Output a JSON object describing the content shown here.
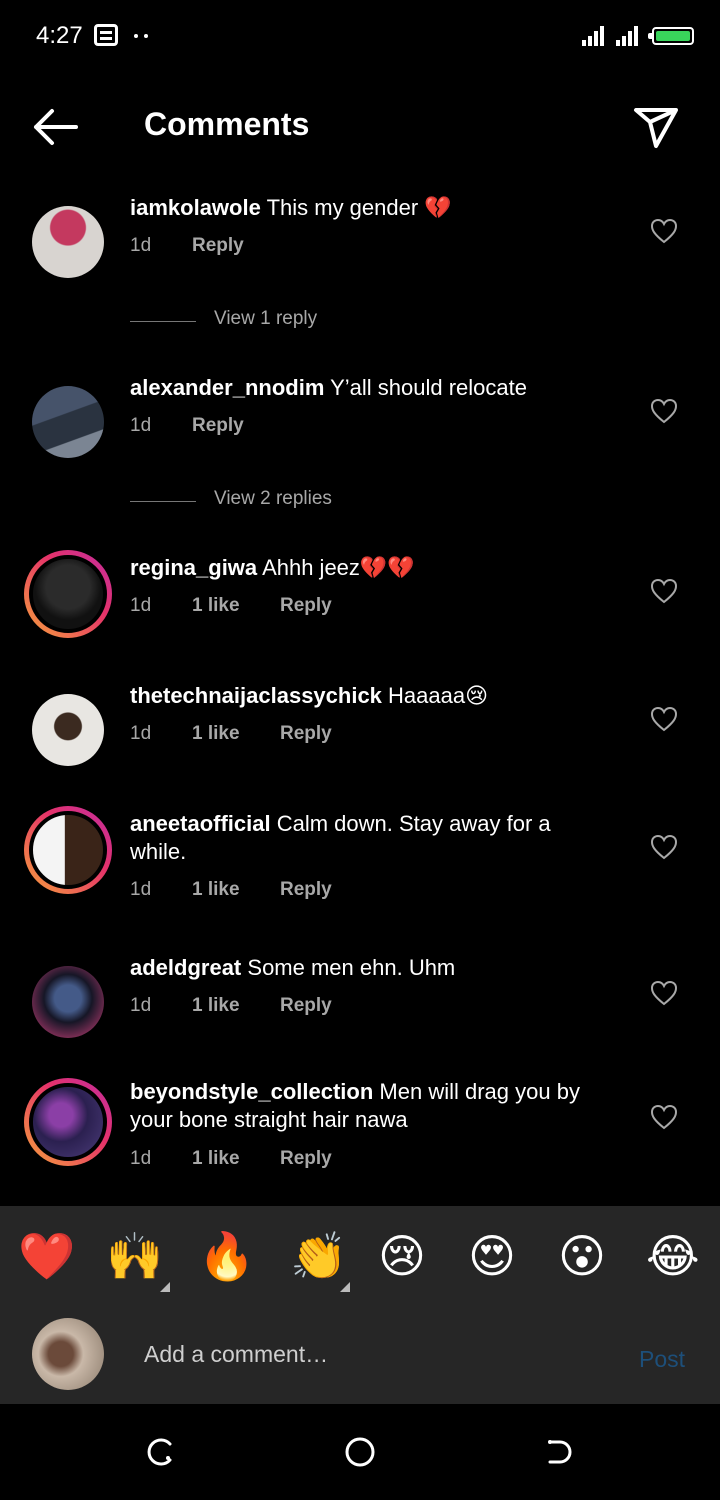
{
  "status_bar": {
    "time": "4:27",
    "battery_color": "#39d45b"
  },
  "header": {
    "title": "Comments",
    "back_icon": "arrow-left-icon",
    "send_icon": "paper-plane-icon"
  },
  "comments": [
    {
      "username": "iamkolawole",
      "text": "This my gender 💔",
      "time": "1d",
      "likes": "",
      "reply": "Reply",
      "ring": false,
      "view_replies": "View 1 reply"
    },
    {
      "username": "alexander_nnodim",
      "text": "Y’all should relocate",
      "time": "1d",
      "likes": "",
      "reply": "Reply",
      "ring": false,
      "view_replies": "View 2 replies"
    },
    {
      "username": "regina_giwa",
      "text": "Ahhh jeez💔💔",
      "time": "1d",
      "likes": "1 like",
      "reply": "Reply",
      "ring": true,
      "view_replies": ""
    },
    {
      "username": "thetechnaijaclassychick",
      "text": "Haaaaa😢",
      "time": "1d",
      "likes": "1 like",
      "reply": "Reply",
      "ring": false,
      "view_replies": ""
    },
    {
      "username": "aneetaofficial",
      "text": "Calm down. Stay away for a while.",
      "time": "1d",
      "likes": "1 like",
      "reply": "Reply",
      "ring": true,
      "view_replies": ""
    },
    {
      "username": "adeldgreat",
      "text": "Some men ehn. Uhm",
      "time": "1d",
      "likes": "1 like",
      "reply": "Reply",
      "ring": false,
      "view_replies": ""
    },
    {
      "username": "beyondstyle_collection",
      "text": "Men will drag you by your bone straight hair nawa",
      "time": "1d",
      "likes": "1 like",
      "reply": "Reply",
      "ring": true,
      "view_replies": ""
    }
  ],
  "emoji_bar": [
    "❤️",
    "🙌",
    "🔥",
    "👏",
    "😢",
    "😍",
    "😮",
    "😂"
  ],
  "comment_box": {
    "placeholder": "Add a comment…",
    "post_label": "Post"
  },
  "nav": {
    "left_icon": "recents-icon",
    "center_icon": "home-circle-icon",
    "right_icon": "back-icon"
  }
}
